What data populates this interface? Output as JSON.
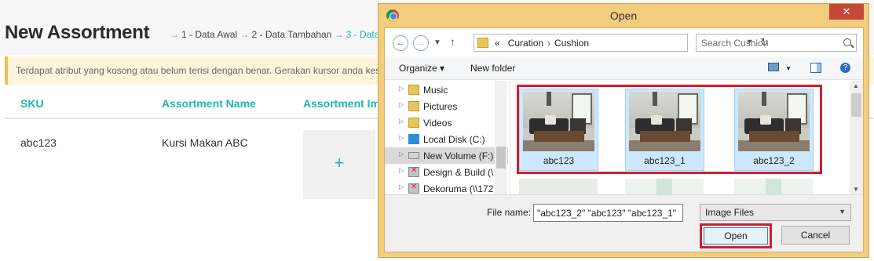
{
  "page": {
    "title": "New Assortment",
    "steps": [
      "1 - Data Awal",
      "2 - Data Tambahan",
      "3 - Data"
    ],
    "step_arrow": "→",
    "alert_text": "Terdapat atribut yang kosong atau belum terisi dengan benar. Gerakan kursor anda kesini"
  },
  "table": {
    "columns": [
      "SKU",
      "Assortment Name",
      "Assortment Im"
    ],
    "row": {
      "sku": "abc123",
      "name": "Kursi Makan ABC",
      "add_icon": "+"
    }
  },
  "dialog": {
    "title": "Open",
    "close_glyph": "✕",
    "address": {
      "prefix": "«",
      "parts": [
        "Curation",
        "Cushion"
      ],
      "separator": "›"
    },
    "search_placeholder": "Search Cushion",
    "toolbar": {
      "organize": "Organize ▾",
      "new_folder": "New folder"
    },
    "nav_items": [
      {
        "label": "Music",
        "icon": "music-folder-icon"
      },
      {
        "label": "Pictures",
        "icon": "pictures-folder-icon"
      },
      {
        "label": "Videos",
        "icon": "videos-folder-icon"
      },
      {
        "label": "Local Disk (C:)",
        "icon": "windows-drive-icon"
      },
      {
        "label": "New Volume (F:)",
        "icon": "drive-icon"
      },
      {
        "label": "Design & Build (\\",
        "icon": "network-drive-icon"
      },
      {
        "label": "Dekoruma (\\\\172",
        "icon": "network-drive-icon"
      }
    ],
    "files": [
      {
        "name": "abc123"
      },
      {
        "name": "abc123_1"
      },
      {
        "name": "abc123_2"
      }
    ],
    "file_name_label": "File name:",
    "file_name_value": "\"abc123_2\" \"abc123\" \"abc123_1\"",
    "file_type": "Image Files",
    "open_label": "Open",
    "cancel_label": "Cancel",
    "colors": {
      "selection_highlight": "#d11f2b",
      "dialog_frame": "#f3cc7e",
      "accent": "#1fb6b0"
    }
  }
}
